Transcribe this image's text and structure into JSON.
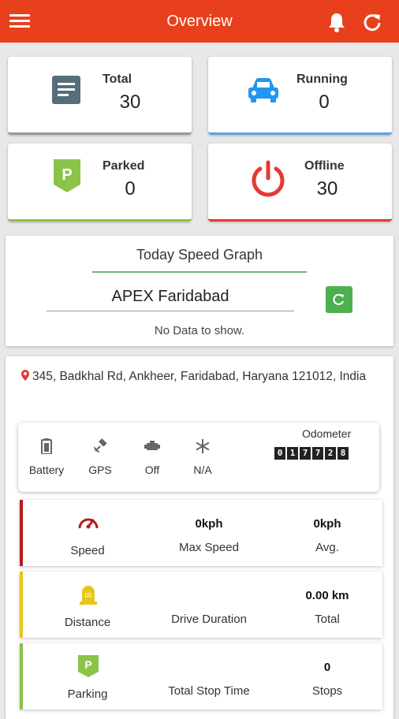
{
  "header": {
    "title": "Overview"
  },
  "stats": {
    "total": {
      "label": "Total",
      "value": "30"
    },
    "running": {
      "label": "Running",
      "value": "0"
    },
    "parked": {
      "label": "Parked",
      "value": "0"
    },
    "offline": {
      "label": "Offline",
      "value": "30"
    }
  },
  "graph": {
    "title": "Today Speed Graph",
    "device": "APEX Faridabad",
    "no_data": "No Data to show."
  },
  "location": {
    "address": "345, Badkhal Rd, Ankheer, Faridabad, Haryana 121012, India"
  },
  "status": {
    "battery": "Battery",
    "gps": "GPS",
    "ignition": "Off",
    "ac": "N/A",
    "odometer_label": "Odometer",
    "odometer_digits": [
      "0",
      "1",
      "7",
      "7",
      "2",
      "8"
    ]
  },
  "metrics": {
    "speed": {
      "label": "Speed",
      "max_value": "0kph",
      "max_label": "Max Speed",
      "avg_value": "0kph",
      "avg_label": "Avg."
    },
    "distance": {
      "label": "Distance",
      "icon_text": "05",
      "duration_value": "",
      "duration_label": "Drive Duration",
      "total_value": "0.00 km",
      "total_label": "Total"
    },
    "parking": {
      "label": "Parking",
      "icon_text": "P",
      "stop_value": "",
      "stop_label": "Total Stop Time",
      "stops_value": "0",
      "stops_label": "Stops"
    }
  },
  "colors": {
    "primary": "#e8401c",
    "running": "#2196f3",
    "parked": "#8bc34a",
    "offline": "#e53935",
    "speed": "#b71c1c",
    "distance": "#e6c619",
    "parking": "#8bc34a",
    "refresh_button": "#4caf50"
  }
}
